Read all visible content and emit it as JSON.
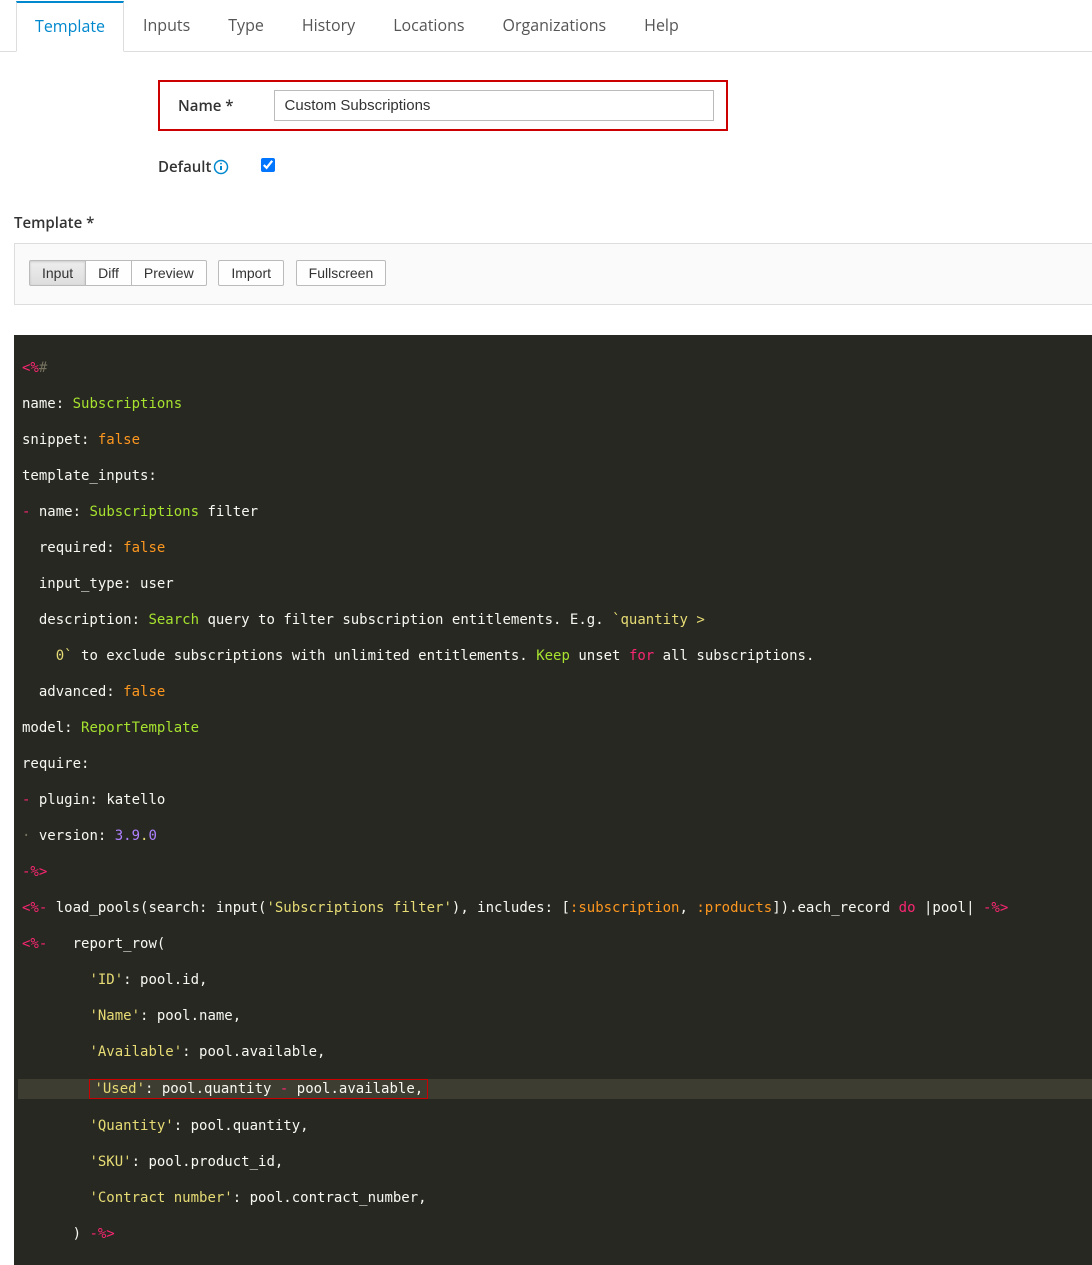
{
  "tabs": {
    "template": "Template",
    "inputs": "Inputs",
    "type": "Type",
    "history": "History",
    "locations": "Locations",
    "organizations": "Organizations",
    "help": "Help"
  },
  "form": {
    "name_label": "Name *",
    "name_value": "Custom Subscriptions",
    "default_label": "Default",
    "default_checked": true
  },
  "template_label": "Template *",
  "toolbar": {
    "input": "Input",
    "diff": "Diff",
    "preview": "Preview",
    "import": "Import",
    "fullscreen": "Fullscreen"
  },
  "code": {
    "l1_open": "<%",
    "l1_hash": "#",
    "l2_k": "name:",
    "l2_v": "Subscriptions",
    "l3_k": "snippet:",
    "l3_v": "false",
    "l4_k": "template_inputs:",
    "l5_d": "-",
    "l5_k": "name:",
    "l5_v": "Subscriptions",
    "l5_v2": "filter",
    "l6_k": "required:",
    "l6_v": "false",
    "l7_k": "input_type:",
    "l7_v": "user",
    "l8_k": "description:",
    "l8_v": "Search",
    "l8_t": "query to filter subscription entitlements. E.g.",
    "l8_q": "`quantity >",
    "l9_q": "0`",
    "l9_t1": "to exclude subscriptions with unlimited entitlements.",
    "l9_k": "Keep",
    "l9_t2": "unset",
    "l9_for": "for",
    "l9_t3": "all subscriptions.",
    "l10_k": "advanced:",
    "l10_v": "false",
    "l11_k": "model:",
    "l11_v": "ReportTemplate",
    "l12_k": "require:",
    "l13_d": "-",
    "l13_k": "plugin:",
    "l13_v": "katello",
    "l14_d": "·",
    "l14_k": "version:",
    "l14_v1": "3.9",
    "l14_dot": ".",
    "l14_v2": "0",
    "l15": "-%>",
    "l16_open": "<%-",
    "l16_a": "load_pools(search: input(",
    "l16_s": "'Subscriptions filter'",
    "l16_b": "), includes: [",
    "l16_sym1": ":subscription",
    "l16_c": ",",
    "l16_sym2": ":products",
    "l16_d": "]).each_record",
    "l16_do": "do",
    "l16_e": "|pool|",
    "l16_close": "-%>",
    "l17_open": "<%-",
    "l17_a": "   report_row(",
    "l18_s": "'ID'",
    "l18_c": ": pool.id,",
    "l19_s": "'Name'",
    "l19_c": ": pool.name,",
    "l20_s": "'Available'",
    "l20_c": ": pool.available,",
    "l21_s": "'Used'",
    "l21_a": ": pool.quantity",
    "l21_op": "-",
    "l21_b": "pool.available,",
    "l22_s": "'Quantity'",
    "l22_c": ": pool.quantity,",
    "l23_s": "'SKU'",
    "l23_c": ": pool.product_id,",
    "l24_s": "'Contract number'",
    "l24_c": ": pool.contract_number,",
    "l25_a": ")",
    "l25_close": "-%>"
  }
}
